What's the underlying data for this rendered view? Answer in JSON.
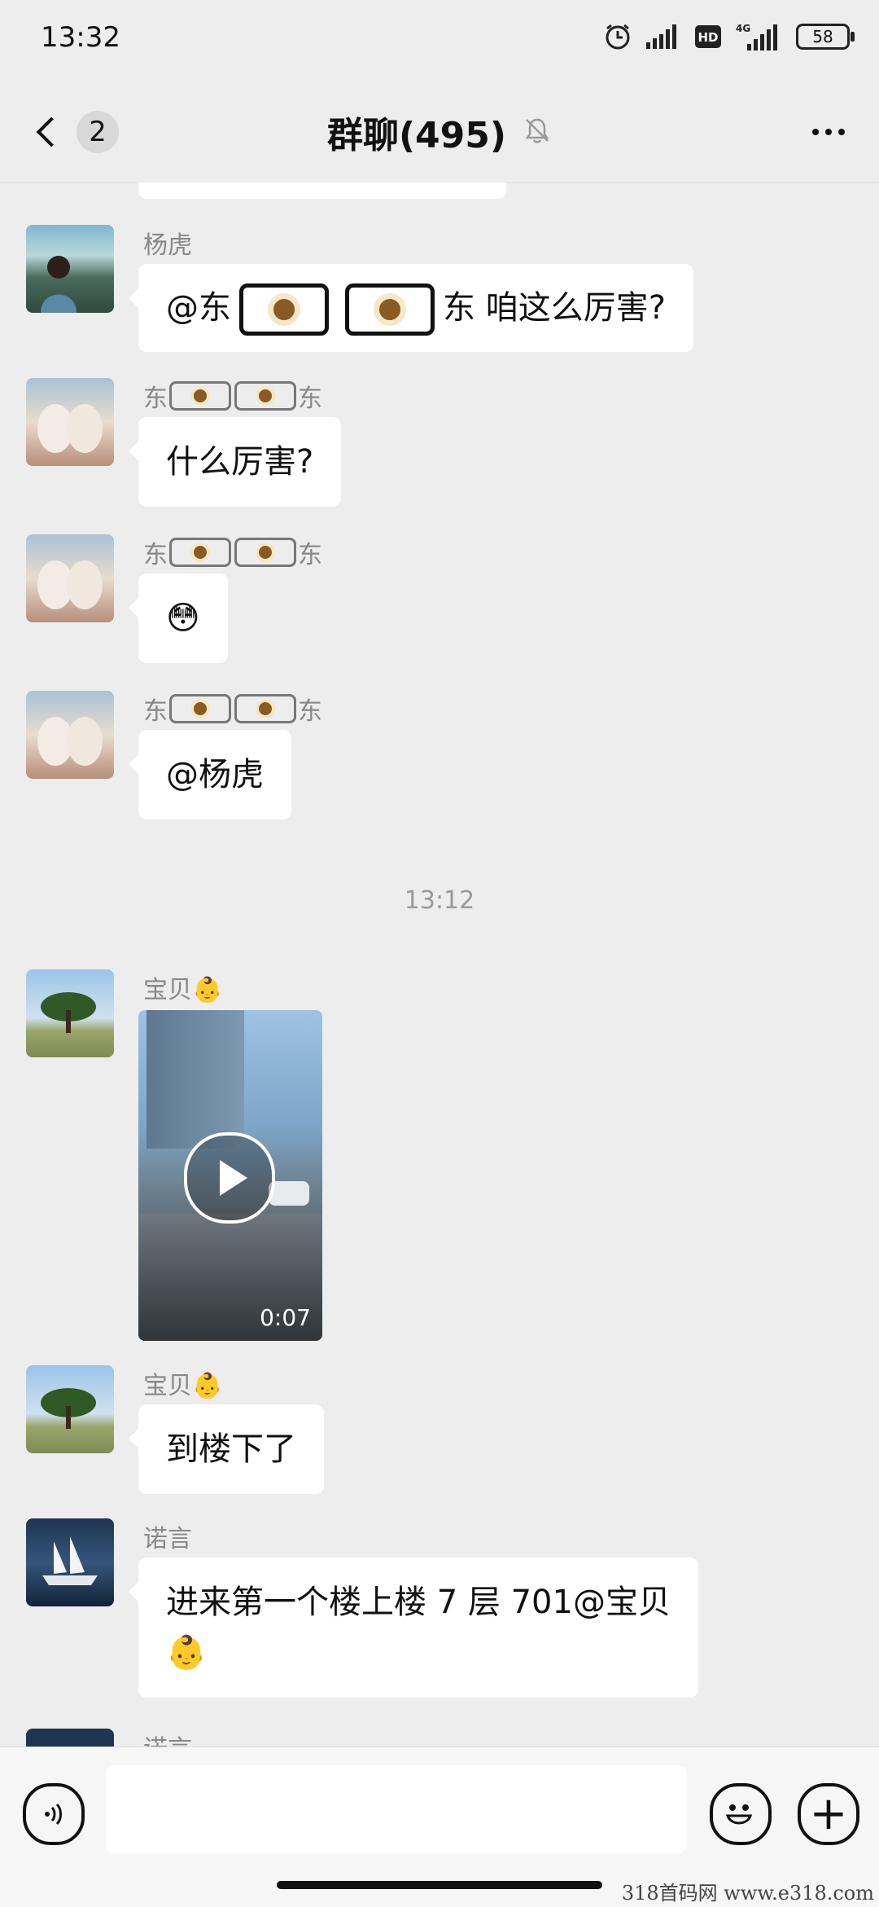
{
  "status_bar": {
    "time": "13:32",
    "battery": "58",
    "hd": "HD",
    "network": "4G"
  },
  "nav": {
    "back_count": "2",
    "title": "群聊(495)"
  },
  "messages": [
    {
      "sender": "杨虎",
      "text_before": "@东",
      "text_after": "东 咱这么厉害?"
    },
    {
      "sender_prefix": "东",
      "sender_suffix": "东",
      "text": "什么厉害?"
    },
    {
      "sender_prefix": "东",
      "sender_suffix": "东",
      "text": "😳"
    },
    {
      "sender_prefix": "东",
      "sender_suffix": "东",
      "text": "@杨虎"
    },
    {
      "sender": "宝贝👶",
      "video_duration": "0:07"
    },
    {
      "sender": "宝贝👶",
      "text": "到楼下了"
    },
    {
      "sender": "诺言",
      "text_line1": "进来第一个楼上楼 7 层 701@宝贝",
      "text_line2": "👶"
    },
    {
      "sender": "诺言"
    }
  ],
  "timestamp": "13:12",
  "icons": [
    "back-chevron-icon",
    "alarm-icon",
    "signal-icon",
    "hd-icon",
    "battery-icon",
    "mute-bell-icon",
    "more-icon",
    "play-icon",
    "voice-icon",
    "emoji-icon",
    "plus-icon"
  ],
  "watermark": "318首码网  www.e318.com"
}
